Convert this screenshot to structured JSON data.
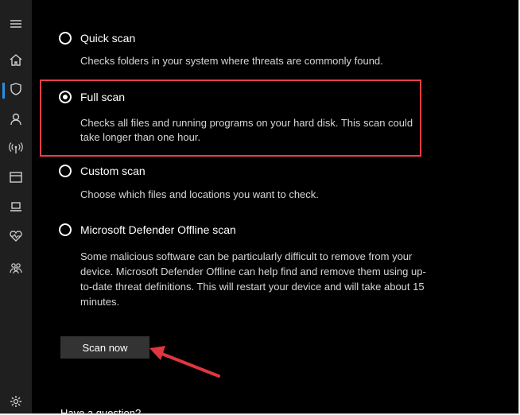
{
  "sidebar": {
    "icons": [
      "menu-icon",
      "home-icon",
      "shield-icon",
      "person-icon",
      "wireless-icon",
      "window-icon",
      "laptop-icon",
      "heart-icon",
      "family-icon",
      "gear-icon"
    ],
    "accent": "#2b8fe0"
  },
  "options": [
    {
      "label": "Quick scan",
      "description": "Checks folders in your system where threats are commonly found.",
      "checked": false
    },
    {
      "label": "Full scan",
      "description": "Checks all files and running programs on your hard disk. This scan could take longer than one hour.",
      "checked": true
    },
    {
      "label": "Custom scan",
      "description": "Choose which files and locations you want to check.",
      "checked": false
    },
    {
      "label": "Microsoft Defender Offline scan",
      "description": "Some malicious software can be particularly difficult to remove from your device. Microsoft Defender Offline can help find and remove them using up-to-date threat definitions. This will restart your device and will take about 15 minutes.",
      "checked": false
    }
  ],
  "scan_button": {
    "label": "Scan now"
  },
  "annotation": {
    "highlight_color": "#e8404a",
    "arrow_color": "#e0363e"
  },
  "footer": {
    "partial_text": "Have a question?"
  }
}
